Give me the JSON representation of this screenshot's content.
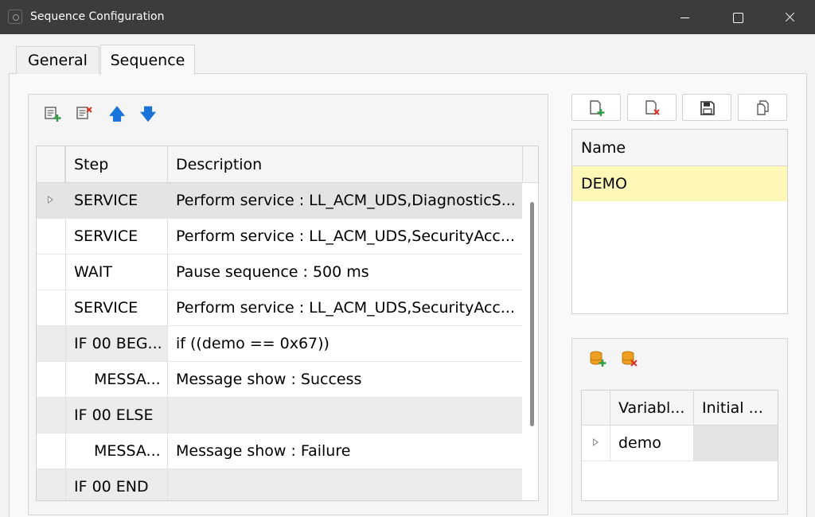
{
  "window": {
    "title": "Sequence Configuration"
  },
  "tabs": [
    {
      "label": "General",
      "selected": false
    },
    {
      "label": "Sequence",
      "selected": true
    }
  ],
  "sequence_toolbar": {
    "icons": [
      "add-step-icon",
      "delete-step-icon",
      "move-up-icon",
      "move-down-icon"
    ],
    "up_glyph": "🡅",
    "down_glyph": "🡇"
  },
  "steps_table": {
    "columns": [
      "Step",
      "Description"
    ],
    "rows": [
      {
        "step": "SERVICE",
        "description": "Perform service : LL_ACM_UDS,DiagnosticS...",
        "indent": false
      },
      {
        "step": "SERVICE",
        "description": "Perform service : LL_ACM_UDS,SecurityAcc...",
        "indent": false
      },
      {
        "step": "WAIT",
        "description": "Pause sequence : 500 ms",
        "indent": false
      },
      {
        "step": "SERVICE",
        "description": "Perform service : LL_ACM_UDS,SecurityAcc...",
        "indent": false
      },
      {
        "step": "IF 00 BEG...",
        "description": "if ((demo == 0x67))",
        "indent": false
      },
      {
        "step": "MESSA...",
        "description": "Message show : Success",
        "indent": true
      },
      {
        "step": "IF 00 ELSE",
        "description": "",
        "indent": false
      },
      {
        "step": "MESSA...",
        "description": "Message show : Failure",
        "indent": true
      },
      {
        "step": "IF 00 END",
        "description": "",
        "indent": false
      }
    ]
  },
  "sequence_list": {
    "toolbar_icons": [
      "new-sequence-icon",
      "delete-sequence-icon",
      "save-icon",
      "copy-icon"
    ],
    "header": "Name",
    "items": [
      "DEMO"
    ],
    "selected_color": "#fdf7b8"
  },
  "variables": {
    "toolbar_icons": [
      "add-variable-icon",
      "delete-variable-icon"
    ],
    "columns": [
      "Variabl...",
      "Initial ..."
    ],
    "rows": [
      {
        "name": "demo",
        "initial": ""
      }
    ]
  },
  "colors": {
    "titlebar": "#3c3c3c",
    "accent_arrow": "#1a73d9",
    "add_green": "#2e9e44",
    "delete_red": "#d9342b",
    "db_orange": "#f0a020"
  }
}
